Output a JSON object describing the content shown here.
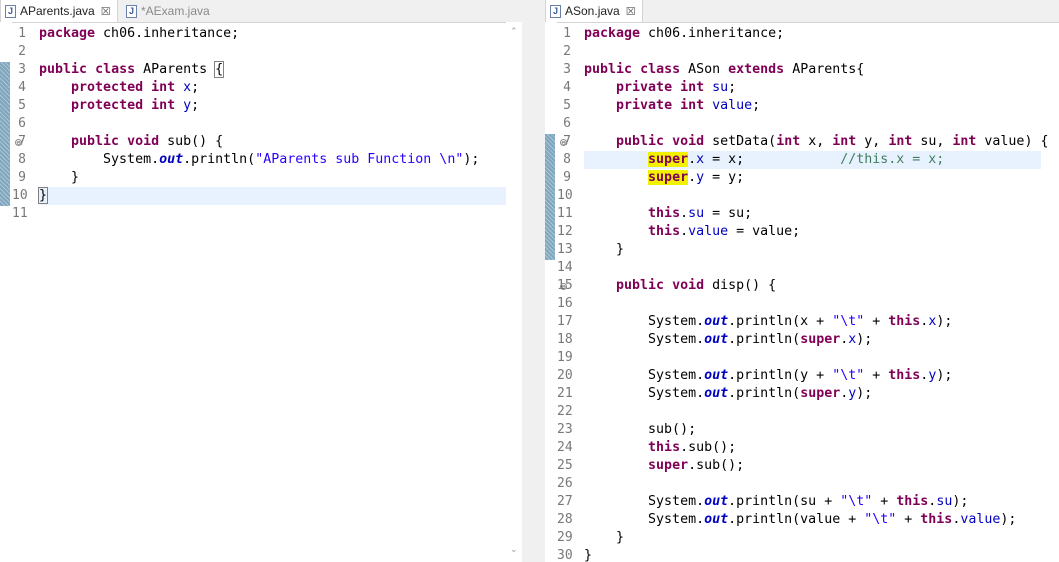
{
  "left_tabs": [
    {
      "label": "AParents.java",
      "close": "☒"
    },
    {
      "label": "*AExam.java"
    }
  ],
  "right_tabs": [
    {
      "label": "ASon.java",
      "close": "☒"
    }
  ],
  "java_icon": "J",
  "scroll_up": "⌃",
  "scroll_down": "⌄",
  "fold_glyph": "⊖",
  "left_editor": {
    "line_numbers": [
      "1",
      "2",
      "3",
      "4",
      "5",
      "6",
      "7",
      "8",
      "9",
      "10",
      "11"
    ],
    "current_line": 10
  },
  "right_editor": {
    "line_numbers": [
      "1",
      "2",
      "3",
      "4",
      "5",
      "6",
      "7",
      "8",
      "9",
      "10",
      "11",
      "12",
      "13",
      "14",
      "15",
      "16",
      "17",
      "18",
      "19",
      "20",
      "21",
      "22",
      "23",
      "24",
      "25",
      "26",
      "27",
      "28",
      "29",
      "30"
    ],
    "current_line": 8
  },
  "colors": {
    "keyword": "#7f0055",
    "field": "#0000c0",
    "string": "#2a00ff",
    "comment": "#3f7f5f",
    "occurrence_highlight": "#f2f200",
    "current_line_bg": "#e8f2fe"
  }
}
